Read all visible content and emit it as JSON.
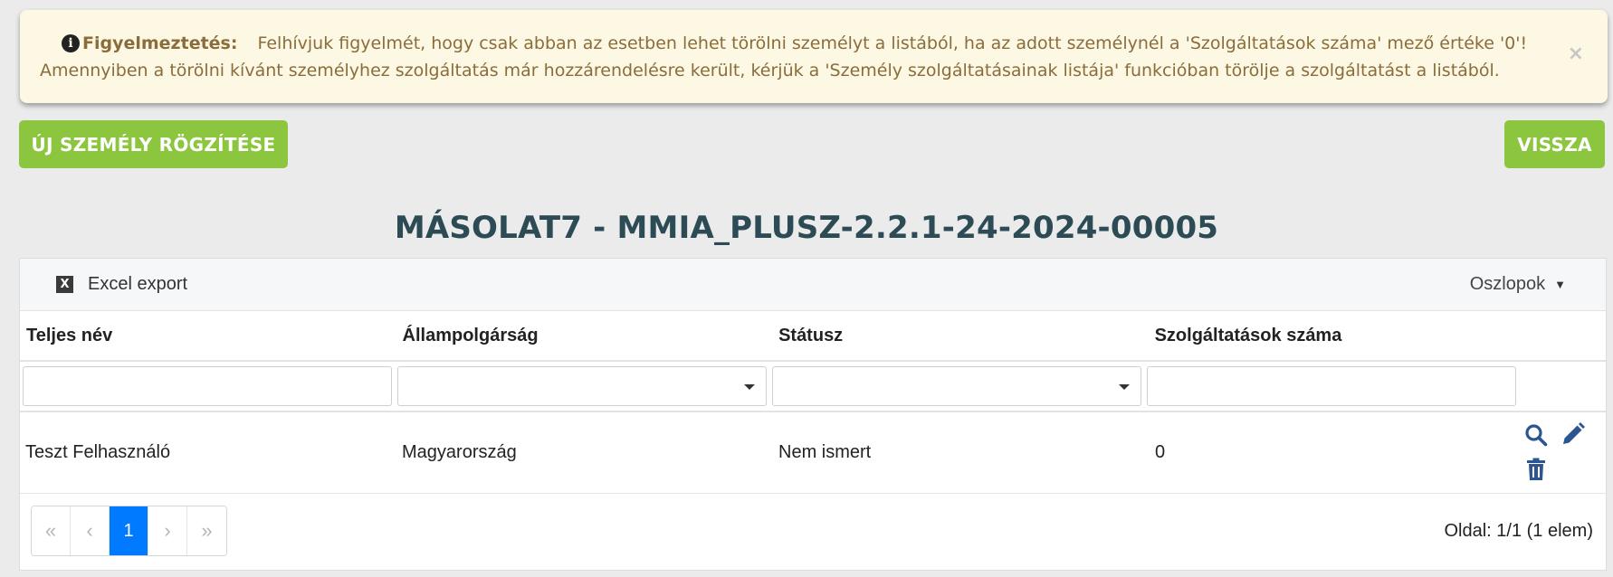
{
  "alert": {
    "icon": "info-circle-icon",
    "title": "Figyelmeztetés:",
    "line1": "Felhívjuk figyelmét, hogy csak abban az esetben lehet törölni személyt a listából, ha az adott személynél a 'Szolgáltatások száma' mező értéke '0'!",
    "line2": "Amennyiben a törölni kívánt személyhez szolgáltatás már hozzárendelésre került, kérjük a 'Személy szolgáltatásainak listája' funkcióban törölje a szolgáltatást a listából.",
    "close": "×"
  },
  "buttons": {
    "new_person": "ÚJ SZEMÉLY RÖGZÍTÉSE",
    "back": "VISSZA"
  },
  "colors": {
    "green": "#8cc63f",
    "title": "#2c4b55",
    "alert_bg": "#fcf8e3",
    "alert_text": "#8a6d3b",
    "primary": "#007bff",
    "action_icon": "#2c5592"
  },
  "page_title": "MÁSOLAT7 - MMIA_PLUSZ-2.2.1-24-2024-00005",
  "toolbar": {
    "excel_icon_text": "X",
    "excel_label": "Excel export",
    "columns_label": "Oszlopok"
  },
  "table": {
    "headers": [
      "Teljes név",
      "Állampolgárság",
      "Státusz",
      "Szolgáltatások száma"
    ],
    "rows": [
      {
        "name": "Teszt Felhasználó",
        "citizenship": "Magyarország",
        "status": "Nem ismert",
        "services": "0"
      }
    ]
  },
  "pager": {
    "first": "«",
    "prev": "‹",
    "current": "1",
    "next": "›",
    "last": "»",
    "info": "Oldal: 1/1 (1 elem)"
  }
}
